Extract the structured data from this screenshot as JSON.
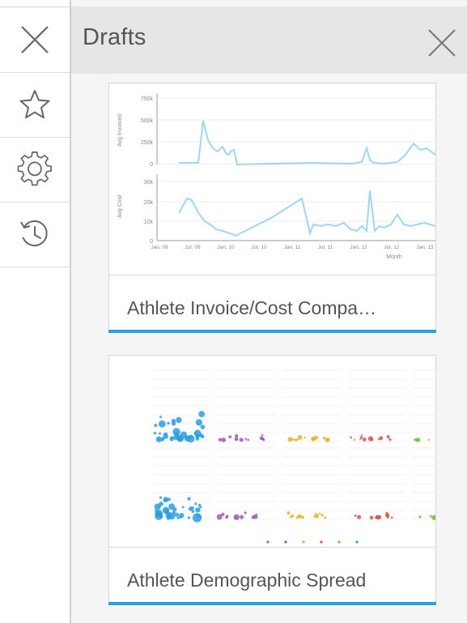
{
  "rail": {
    "items": [
      {
        "icon": "close-icon"
      },
      {
        "icon": "star-icon"
      },
      {
        "icon": "gear-icon"
      },
      {
        "icon": "history-icon"
      }
    ]
  },
  "panel": {
    "title": "Drafts",
    "close_icon": "close-icon"
  },
  "colors": {
    "accent": "#29a0e3",
    "line": "#9fd5f3",
    "header_bg": "#e6e6e6"
  },
  "drafts": [
    {
      "label": "Athlete Invoice/Cost Compa…",
      "thumbnail": {
        "type": "line",
        "top": {
          "ylabel": "Avg Invoiced",
          "ticks": [
            "750k",
            "500k",
            "250k",
            "0"
          ]
        },
        "bottom": {
          "ylabel": "Avg Cost",
          "ticks": [
            "30k",
            "20k",
            "10k",
            "0"
          ]
        },
        "x_ticks": [
          "Jan, 09",
          "Jul, 09",
          "Jan, 10",
          "Jul, 10",
          "Jan, 11",
          "Jul, 11",
          "Jan, 12",
          "Jul, 12",
          "Jan, 13"
        ],
        "xlabel": "Month"
      }
    },
    {
      "label": "Athlete Demographic Spread",
      "thumbnail": {
        "type": "scatter",
        "panels": 5,
        "rows": 2,
        "colors": [
          "#2a9fe0",
          "#9b59b6",
          "#e6b422",
          "#d9534f",
          "#7cc242"
        ]
      }
    }
  ]
}
